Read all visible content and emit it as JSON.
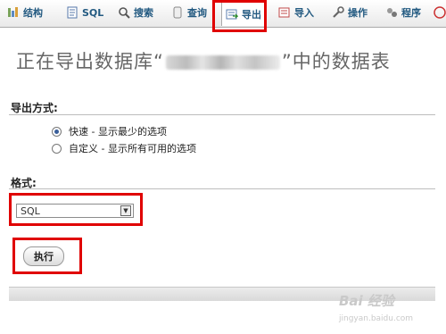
{
  "tabs": [
    {
      "label": "结构",
      "icon": "structure-icon"
    },
    {
      "label": "SQL",
      "icon": "sql-icon"
    },
    {
      "label": "搜索",
      "icon": "search-icon"
    },
    {
      "label": "查询",
      "icon": "query-icon"
    },
    {
      "label": "导出",
      "icon": "export-icon",
      "active": true
    },
    {
      "label": "导入",
      "icon": "import-icon"
    },
    {
      "label": "操作",
      "icon": "wrench-icon"
    },
    {
      "label": "程序",
      "icon": "routines-icon"
    }
  ],
  "heading": {
    "prefix": "正在导出数据库“",
    "suffix": "”中的数据表"
  },
  "export_method": {
    "label": "导出方式:",
    "options": [
      {
        "label": "快速 - 显示最少的选项",
        "selected": true
      },
      {
        "label": "自定义 - 显示所有可用的选项",
        "selected": false
      }
    ]
  },
  "format": {
    "label": "格式:",
    "selected": "SQL"
  },
  "execute_label": "执行",
  "watermark": {
    "main": "Bai 经验",
    "sub": "jingyan.baidu.com"
  },
  "colors": {
    "highlight": "#e00000",
    "tab_text": "#235a81"
  }
}
